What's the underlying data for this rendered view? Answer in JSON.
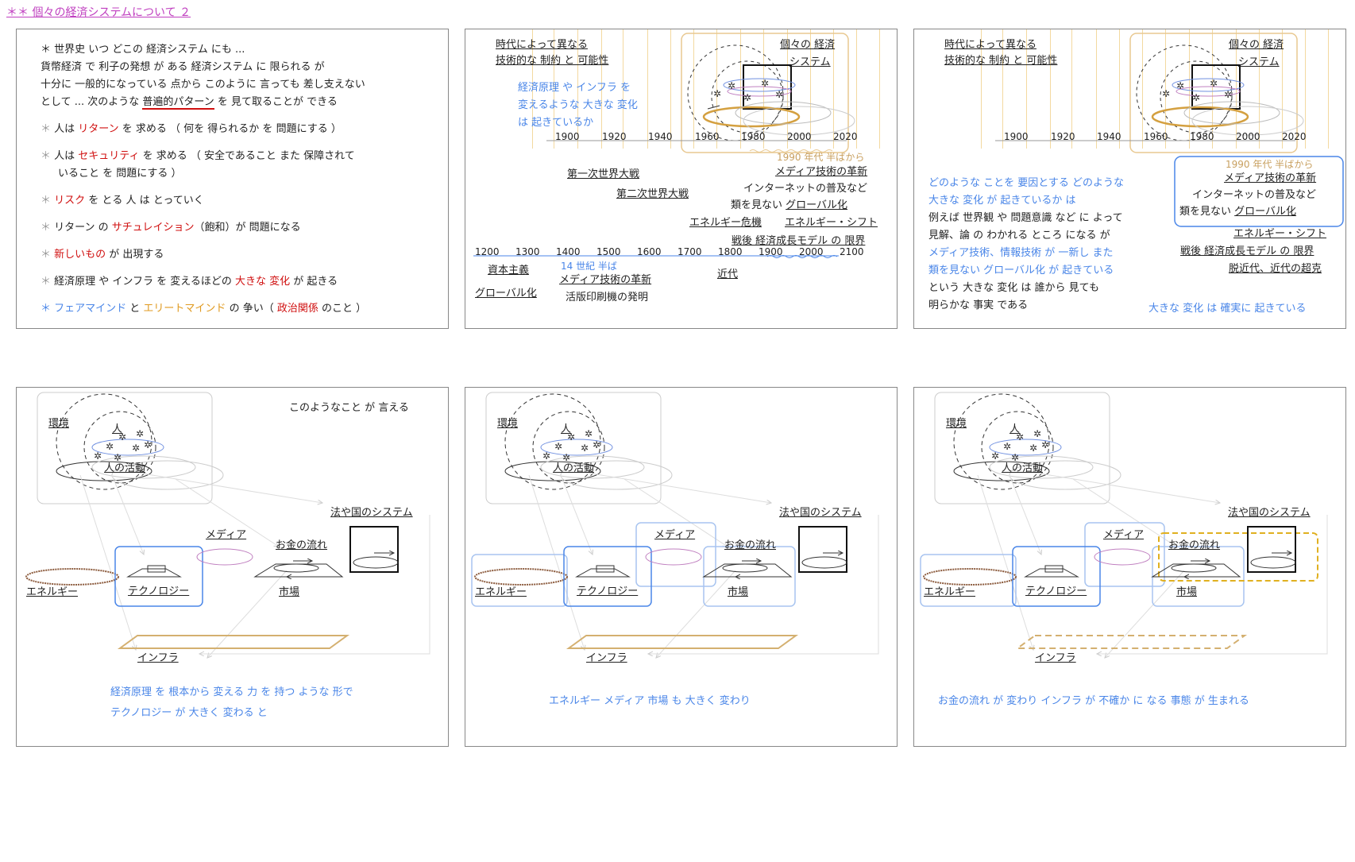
{
  "page_title": "＊＊ 個々の経済システムについて ２",
  "p1": {
    "lines": [
      "＊ 世界史 いつ どこの 経済システム にも ...",
      "貨幣経済 で 利子の発想 が ある 経済システム に 限られる が",
      "十分に 一般的になっている 点から このように 言っても 差し支えない",
      "として ... 次のような"
    ],
    "pattern": "普遍的パターン",
    "pattern_after": "を 見て取ることが できる",
    "items": [
      {
        "pre": "人は ",
        "key": "リターン",
        "post": " を 求める （ 何を 得られるか を 問題にする ）"
      },
      {
        "pre": "人は ",
        "key": "セキュリティ",
        "post": " を 求める （ 安全であること また 保障されて"
      },
      {
        "pre": "",
        "key": "",
        "post": "いること を 問題にする ）"
      },
      {
        "pre": "",
        "key": "リスク",
        "post": " を とる 人 は とっていく"
      },
      {
        "pre": "リターン の ",
        "key": "サチュレイション",
        "post": "（飽和）が 問題になる"
      },
      {
        "pre": "",
        "key": "新しいもの",
        "post": " が 出現する"
      },
      {
        "pre": "経済原理 や インフラ を 変えるほどの ",
        "key": "大きな 変化",
        "post": " が 起きる"
      }
    ],
    "last": {
      "a": "フェアマインド",
      "b": " と ",
      "c": "エリートマインド",
      "d": " の 争い（ ",
      "e": "政治関係",
      "f": " のこと ）"
    }
  },
  "p2": {
    "head1": "時代によって異なる",
    "head2": "技術的な 制約 と 可能性",
    "blue1": "経済原理 や インフラ を",
    "blue2": "変えるような 大きな 変化",
    "blue3": "は 起きているか",
    "sys1": "個々の 経済",
    "sys2": "システム",
    "years_top": [
      "1900",
      "1920",
      "1940",
      "1960",
      "1980",
      "2000",
      "2020"
    ],
    "mid90": "1990 年代 半ばから",
    "media": "メディア技術の革新",
    "internet": "インターネットの普及など",
    "global_pre": "類を見ない",
    "global": "グローバル化",
    "ww1": "第一次世界大戦",
    "ww2": "第二次世界大戦",
    "ecrisis": "エネルギー危機",
    "eshift": "エネルギー・シフト",
    "postwar": "戦後 経済成長モデル の 限界",
    "years_bottom": [
      "1200",
      "1300",
      "1400",
      "1500",
      "1600",
      "1700",
      "1800",
      "1900",
      "2000",
      "2100"
    ],
    "capitalism": "資本主義",
    "c14": "14 世紀 半ば",
    "media2": "メディア技術の革新",
    "modern": "近代",
    "global2": "グローバル化",
    "printing": "活版印刷機の発明"
  },
  "p3": {
    "b1": "どのような ことを 要因とする どのような",
    "b2": "大きな 変化 が 起きているか は",
    "k1": "例えば 世界観 や 問題意識 など に よって",
    "k2": "見解、論 の わかれる ところ になる が",
    "b3": "メディア技術、情報技術 が 一新し また",
    "b4": "類を見ない グローバル化 が 起きている",
    "k3": "という 大きな 変化 は 誰から 見ても",
    "k4": "明らかな 事実 である",
    "post": "脱近代、近代の超克",
    "conclusion": "大きな 変化 は 確実に 起きている"
  },
  "diagram": {
    "env": "環境",
    "person": "人",
    "activity": "人の活動",
    "law": "法や国のシステム",
    "media": "メディア",
    "money": "お金の流れ",
    "energy": "エネルギー",
    "tech": "テクノロジー",
    "market": "市場",
    "infra": "インフラ"
  },
  "p4": {
    "corner": "このようなこと が 言える",
    "cap1": "経済原理 を 根本から 変える 力 を 持つ ような 形で",
    "cap2": "テクノロジー が 大きく 変わる と"
  },
  "p5": {
    "cap": "エネルギー メディア 市場 も 大きく 変わり"
  },
  "p6": {
    "cap": "お金の流れ が 変わり インフラ が 不確か に なる 事態 が 生まれる"
  },
  "colors": {
    "accent": "#4a86e8",
    "red": "#d01010",
    "orange": "#e09a20",
    "tan": "#c8a060",
    "magenta": "#c040c0"
  }
}
